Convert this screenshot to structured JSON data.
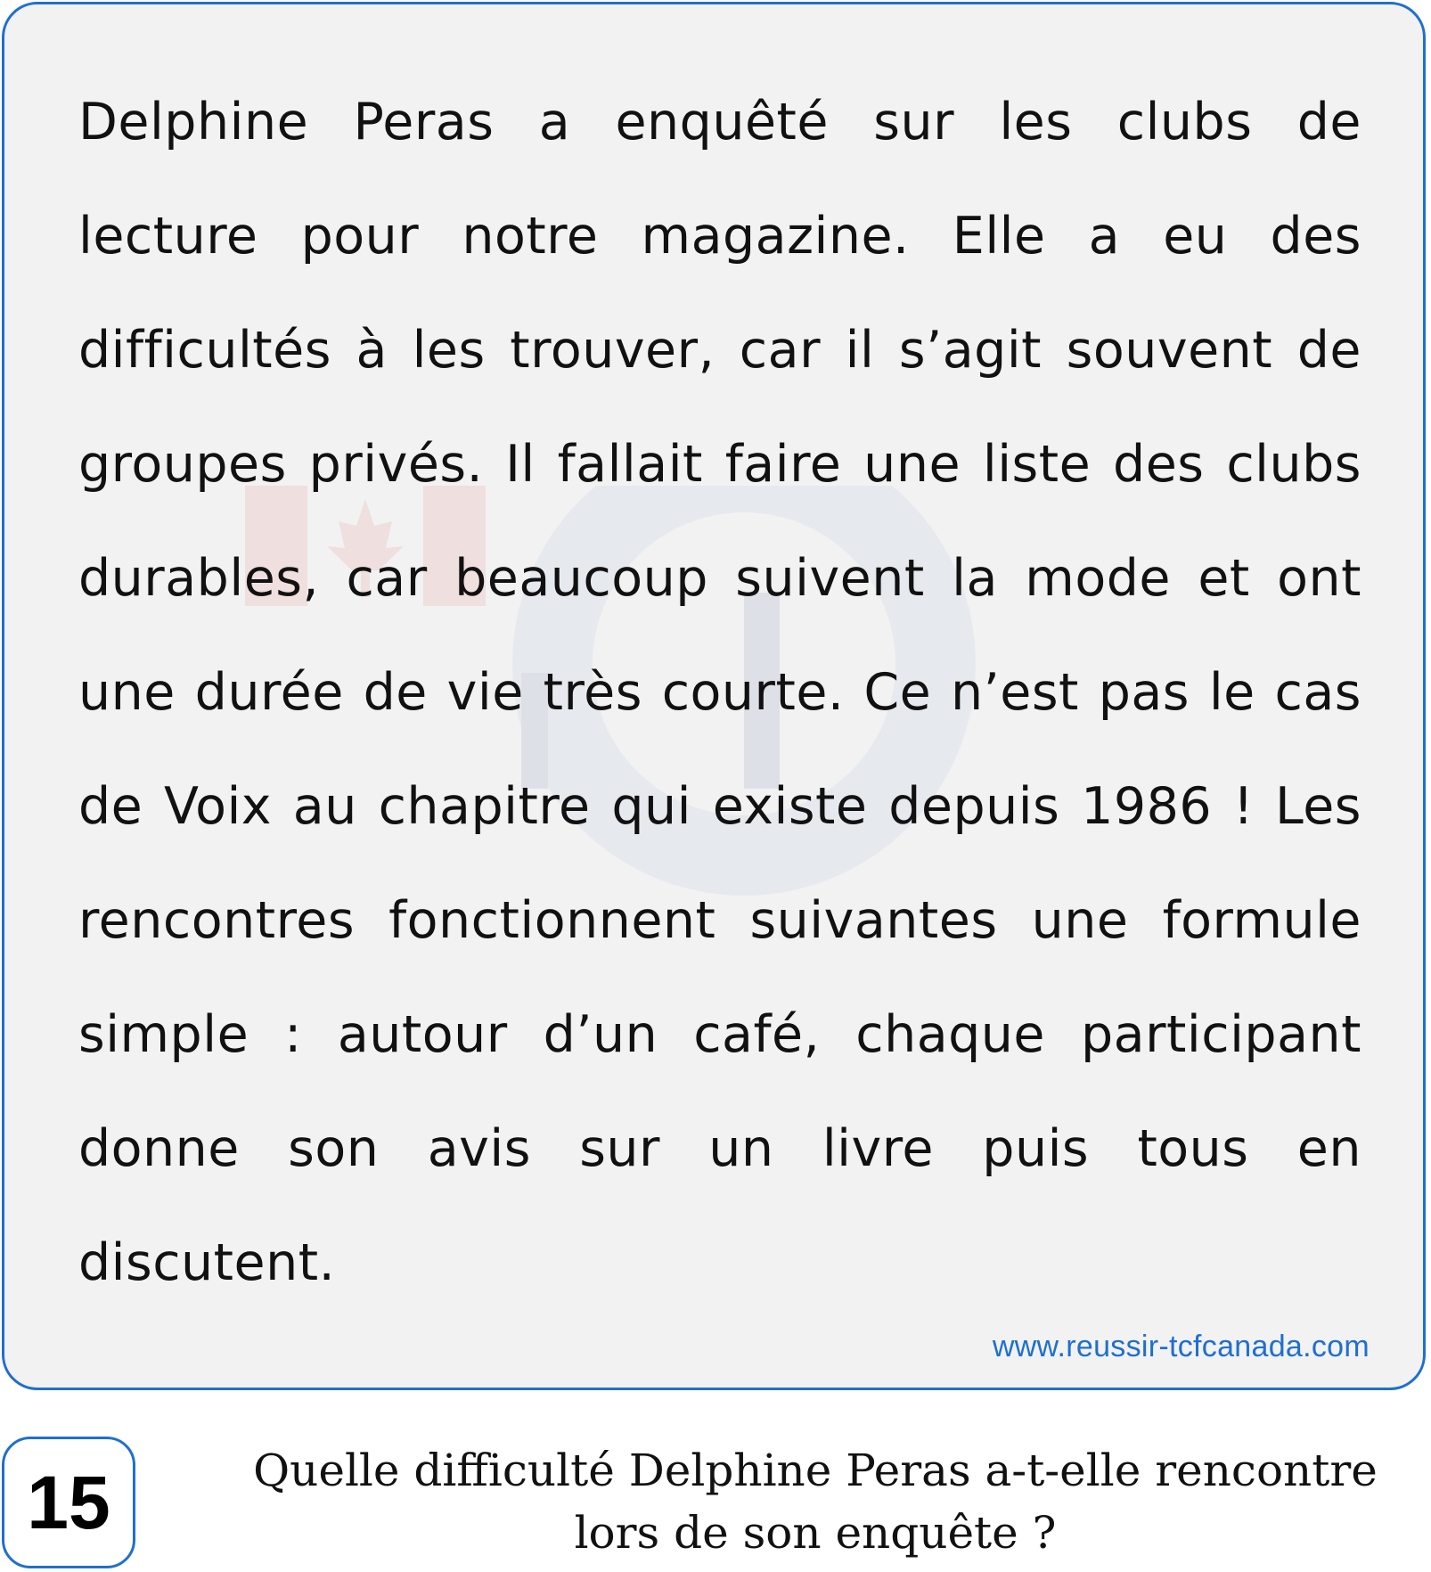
{
  "passage": {
    "text": "Delphine Peras a enquêté sur les clubs de lecture pour notre magazine. Elle a eu des difficultés à les trouver, car il s’agit souvent de groupes privés. Il fallait faire une liste des clubs durables, car beaucoup suivent la mode et ont une durée de vie très courte. Ce n’est pas le cas de Voix au chapitre qui existe depuis 1986 ! Les rencontres fonctionnent suivantes une formule simple : autour d’un café, chaque participant donne son avis sur un livre puis tous en discutent.",
    "website": "www.reussir-tcfcanada.com",
    "border_color": "#1f6fd0",
    "background_color": "#f2f2f2"
  },
  "question": {
    "number": "15",
    "text": "Quelle difficulté Delphine Peras a-t-elle rencontre lors de son enquête ?"
  },
  "watermark": {
    "icons": [
      "canada-flag-icon",
      "tcf-canada-logo-icon"
    ]
  }
}
